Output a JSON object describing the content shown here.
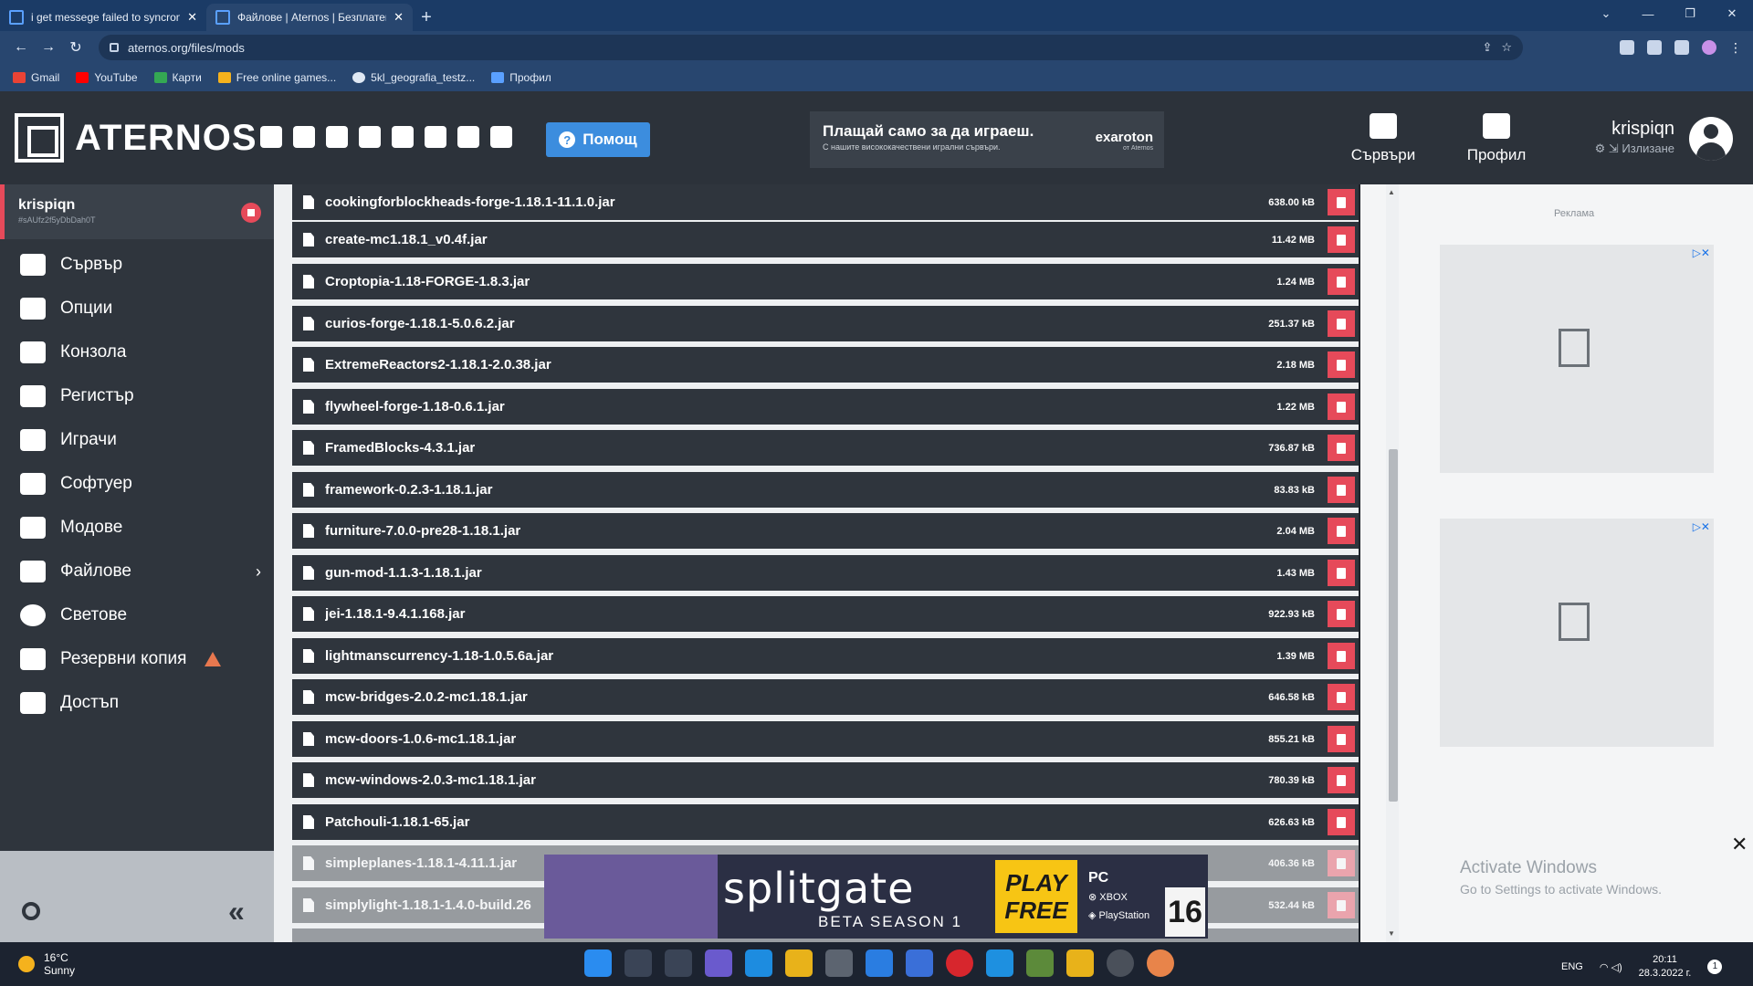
{
  "browser": {
    "tabs": [
      {
        "title": "i get messege failed to syncrony"
      },
      {
        "title": "Файлове | Aternos | Безплатен М"
      }
    ],
    "url": "aternos.org/files/mods",
    "bookmarks": [
      "Gmail",
      "YouTube",
      "Карти",
      "Free online games...",
      "5kl_geografia_testz...",
      "Профил"
    ]
  },
  "header": {
    "brand": "ATERNOS",
    "help_label": "Помощ",
    "ad_headline": "Плащай само за да играеш.",
    "ad_sub": "С нашите висококачествени игрални сървъри.",
    "ad_brand": "exaroton",
    "ad_brand_sub": "от Aternos",
    "nav_servers": "Сървъри",
    "nav_profile": "Профил",
    "username": "krispiqn",
    "logout": "Излизане"
  },
  "sidebar": {
    "server_name": "krispiqn",
    "server_id": "#sAUfz2f5yDbDah0T",
    "items": [
      {
        "label": "Сървър"
      },
      {
        "label": "Опции"
      },
      {
        "label": "Конзола"
      },
      {
        "label": "Регистър"
      },
      {
        "label": "Играчи"
      },
      {
        "label": "Софтуер"
      },
      {
        "label": "Модове"
      },
      {
        "label": "Файлове"
      },
      {
        "label": "Светове"
      },
      {
        "label": "Резервни копия"
      },
      {
        "label": "Достъп"
      }
    ]
  },
  "files": [
    {
      "name": "cookingforblockheads-forge-1.18.1-11.1.0.jar",
      "size": "638.00 kB"
    },
    {
      "name": "create-mc1.18.1_v0.4f.jar",
      "size": "11.42 MB"
    },
    {
      "name": "Croptopia-1.18-FORGE-1.8.3.jar",
      "size": "1.24 MB"
    },
    {
      "name": "curios-forge-1.18.1-5.0.6.2.jar",
      "size": "251.37 kB"
    },
    {
      "name": "ExtremeReactors2-1.18.1-2.0.38.jar",
      "size": "2.18 MB"
    },
    {
      "name": "flywheel-forge-1.18-0.6.1.jar",
      "size": "1.22 MB"
    },
    {
      "name": "FramedBlocks-4.3.1.jar",
      "size": "736.87 kB"
    },
    {
      "name": "framework-0.2.3-1.18.1.jar",
      "size": "83.83 kB"
    },
    {
      "name": "furniture-7.0.0-pre28-1.18.1.jar",
      "size": "2.04 MB"
    },
    {
      "name": "gun-mod-1.1.3-1.18.1.jar",
      "size": "1.43 MB"
    },
    {
      "name": "jei-1.18.1-9.4.1.168.jar",
      "size": "922.93 kB"
    },
    {
      "name": "lightmanscurrency-1.18-1.0.5.6a.jar",
      "size": "1.39 MB"
    },
    {
      "name": "mcw-bridges-2.0.2-mc1.18.1.jar",
      "size": "646.58 kB"
    },
    {
      "name": "mcw-doors-1.0.6-mc1.18.1.jar",
      "size": "855.21 kB"
    },
    {
      "name": "mcw-windows-2.0.3-mc1.18.1.jar",
      "size": "780.39 kB"
    },
    {
      "name": "Patchouli-1.18.1-65.jar",
      "size": "626.63 kB"
    },
    {
      "name": "simpleplanes-1.18.1-4.11.1.jar",
      "size": "406.36 kB"
    },
    {
      "name": "simplylight-1.18.1-1.4.0-build.26",
      "size": "532.44 kB"
    }
  ],
  "right": {
    "ad_label": "Реклама"
  },
  "bottom_ad": {
    "title": "splitgate",
    "season": "BETA SEASON 1",
    "play": "PLAY FREE",
    "platform_pc": "PC",
    "platform_xbox": "XBOX",
    "platform_ps": "PlayStation",
    "pegi": "16"
  },
  "activation": {
    "title": "Activate Windows",
    "subtitle": "Go to Settings to activate Windows."
  },
  "taskbar": {
    "temp": "16°C",
    "weather": "Sunny",
    "lang": "ENG",
    "time": "20:11",
    "date": "28.3.2022 г.",
    "notifications": "1"
  }
}
